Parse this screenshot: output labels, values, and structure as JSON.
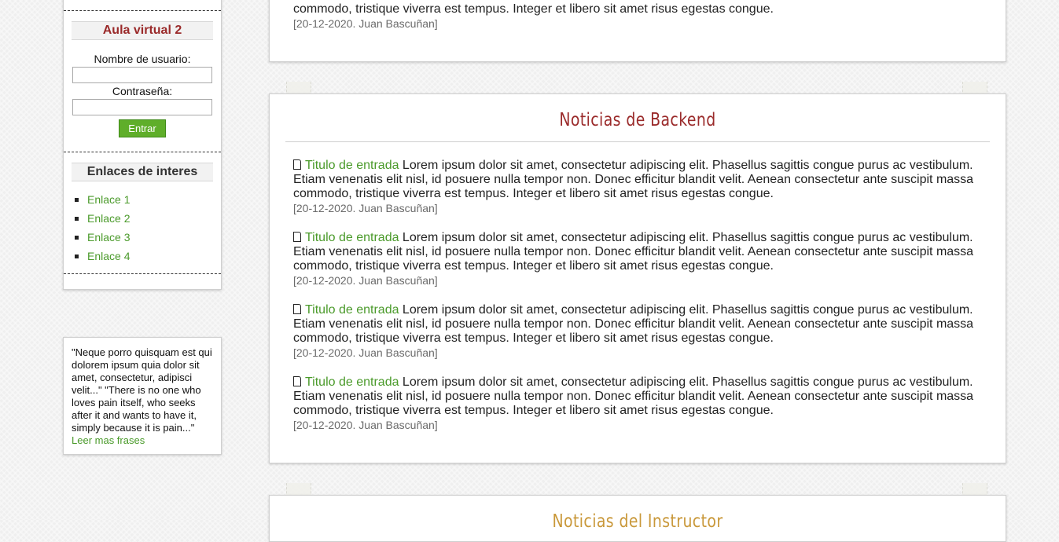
{
  "login": {
    "title": "Aula virtual 2",
    "username_label": "Nombre de usuario:",
    "username_value": "",
    "password_label": "Contraseña:",
    "password_value": "",
    "submit_label": "Entrar"
  },
  "links": {
    "title": "Enlaces de interes",
    "items": [
      {
        "label": "Enlace 1"
      },
      {
        "label": "Enlace 2"
      },
      {
        "label": "Enlace 3"
      },
      {
        "label": "Enlace 4"
      }
    ]
  },
  "quote": {
    "text": "\"Neque porro quisquam est qui dolorem ipsum quia dolor sit amet, consectetur, adipisci velit...\" \"There is no one who loves pain itself, who seeks after it and wants to have it, simply because it is pain...\"",
    "link_label": "Leer mas frases"
  },
  "top_panel": {
    "partial_text": "commodo, tristique viverra est tempus. Integer et libero sit amet risus egestas congue.",
    "meta": "[20-12-2020. Juan Bascuñan]"
  },
  "backend": {
    "title": "Noticias de Backend",
    "entries": [
      {
        "link": "Titulo de entrada",
        "body": " Lorem ipsum dolor sit amet, consectetur adipiscing elit. Phasellus sagittis congue purus ac vestibulum. Etiam venenatis elit nisl, id posuere nulla tempor non. Donec efficitur blandit velit. Aenean consectetur ante suscipit massa commodo, tristique viverra est tempus. Integer et libero sit amet risus egestas congue.",
        "meta": "[20-12-2020. Juan Bascuñan]"
      },
      {
        "link": "Titulo de entrada",
        "body": " Lorem ipsum dolor sit amet, consectetur adipiscing elit. Phasellus sagittis congue purus ac vestibulum. Etiam venenatis elit nisl, id posuere nulla tempor non. Donec efficitur blandit velit. Aenean consectetur ante suscipit massa commodo, tristique viverra est tempus. Integer et libero sit amet risus egestas congue.",
        "meta": "[20-12-2020. Juan Bascuñan]"
      },
      {
        "link": "Titulo de entrada",
        "body": " Lorem ipsum dolor sit amet, consectetur adipiscing elit. Phasellus sagittis congue purus ac vestibulum. Etiam venenatis elit nisl, id posuere nulla tempor non. Donec efficitur blandit velit. Aenean consectetur ante suscipit massa commodo, tristique viverra est tempus. Integer et libero sit amet risus egestas congue.",
        "meta": "[20-12-2020. Juan Bascuñan]"
      },
      {
        "link": "Titulo de entrada",
        "body": " Lorem ipsum dolor sit amet, consectetur adipiscing elit. Phasellus sagittis congue purus ac vestibulum. Etiam venenatis elit nisl, id posuere nulla tempor non. Donec efficitur blandit velit. Aenean consectetur ante suscipit massa commodo, tristique viverra est tempus. Integer et libero sit amet risus egestas congue.",
        "meta": "[20-12-2020. Juan Bascuñan]"
      }
    ]
  },
  "instructor": {
    "title": "Noticias del Instructor"
  },
  "colors": {
    "accent_red": "#9a2a2a",
    "link_green": "#4a9a2a",
    "button_green": "#5fae2a",
    "accent_gold": "#c9983a"
  }
}
